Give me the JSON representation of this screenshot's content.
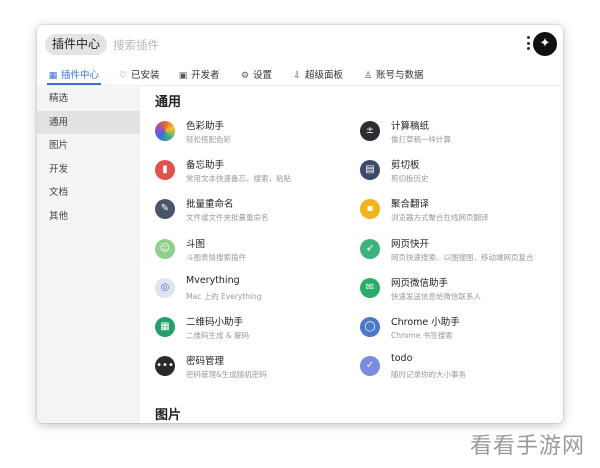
{
  "header": {
    "plugin_center_label": "插件中心",
    "search_placeholder": "搜索插件",
    "more_icon": "vertical-ellipsis-icon",
    "logo_icon": "app-logo-icon"
  },
  "tabs": [
    {
      "label": "插件中心",
      "icon": "grid-icon",
      "glyph": "▦",
      "active": true
    },
    {
      "label": "已安装",
      "icon": "heart-icon",
      "glyph": "♡",
      "active": false
    },
    {
      "label": "开发者",
      "icon": "code-icon",
      "glyph": "▣",
      "active": false
    },
    {
      "label": "设置",
      "icon": "gear-icon",
      "glyph": "⚙",
      "active": false
    },
    {
      "label": "超级面板",
      "icon": "panel-icon",
      "glyph": "⇩",
      "active": false
    },
    {
      "label": "账号与数据",
      "icon": "user-icon",
      "glyph": "♙",
      "active": false
    }
  ],
  "sidebar": {
    "items": [
      {
        "label": "精选",
        "active": false
      },
      {
        "label": "通用",
        "active": true
      },
      {
        "label": "图片",
        "active": false
      },
      {
        "label": "开发",
        "active": false
      },
      {
        "label": "文档",
        "active": false
      },
      {
        "label": "其他",
        "active": false
      }
    ]
  },
  "sections": [
    {
      "title": "通用",
      "plugins": [
        {
          "name": "色彩助手",
          "desc": "轻松搭配色彩",
          "icon": "color-wheel-icon",
          "glyph": "●",
          "color": "#e8632b"
        },
        {
          "name": "计算稿纸",
          "desc": "像打草稿一样计算",
          "icon": "calculator-icon",
          "glyph": "±",
          "color": "#2b2d33"
        },
        {
          "name": "备忘助手",
          "desc": "常用文本快速备忘，搜索，粘贴",
          "icon": "memo-icon",
          "glyph": "▮",
          "color": "#e2514c"
        },
        {
          "name": "剪切板",
          "desc": "剪切板历史",
          "icon": "clipboard-icon",
          "glyph": "▤",
          "color": "#3b4a6b"
        },
        {
          "name": "批量重命名",
          "desc": "文件或文件夹批量重命名",
          "icon": "rename-icon",
          "glyph": "✎",
          "color": "#4a5568"
        },
        {
          "name": "聚合翻译",
          "desc": "浏览器方式聚合在线网页翻译",
          "icon": "translate-icon",
          "glyph": "▪",
          "color": "#f2b31b"
        },
        {
          "name": "斗图",
          "desc": "斗图表情搜索插件",
          "icon": "meme-icon",
          "glyph": "☺",
          "color": "#8fcf8a"
        },
        {
          "name": "网页快开",
          "desc": "网页快速搜索、以图搜图、移动端网页复合",
          "icon": "rocket-icon",
          "glyph": "➶",
          "color": "#3bb37b"
        },
        {
          "name": "Mverything",
          "desc": "Mac 上的 Everything",
          "icon": "magnifier-icon",
          "glyph": "◎",
          "color": "#dfe5f0"
        },
        {
          "name": "网页微信助手",
          "desc": "快速发送信息给微信联系人",
          "icon": "wechat-icon",
          "glyph": "✉",
          "color": "#2aae67"
        },
        {
          "name": "二维码小助手",
          "desc": "二维码生成 & 解码",
          "icon": "qrcode-icon",
          "glyph": "▦",
          "color": "#26a06a"
        },
        {
          "name": "Chrome 小助手",
          "desc": "Chrome 书签搜索",
          "icon": "chrome-icon",
          "glyph": "◯",
          "color": "#4a79c9"
        },
        {
          "name": "密码管理",
          "desc": "密码管理&生成随机密码",
          "icon": "password-icon",
          "glyph": "•••",
          "color": "#2a2a2a"
        },
        {
          "name": "todo",
          "desc": "随时记录你的大小事务",
          "icon": "todo-check-icon",
          "glyph": "✓",
          "color": "#7b8be0"
        }
      ]
    },
    {
      "title": "图片",
      "plugins": []
    }
  ],
  "watermark": "看看手游网"
}
